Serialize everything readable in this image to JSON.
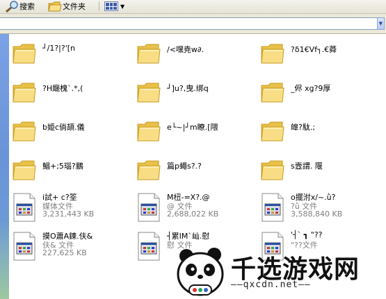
{
  "toolbar": {
    "search_label": "搜索",
    "folders_label": "文件夹",
    "search_icon": "magnifier-icon",
    "folders_icon": "folder-icon",
    "views_icon": "views-grid-icon"
  },
  "address": {
    "value": ""
  },
  "folders": [
    {
      "name": "┘/1?|?'[n"
    },
    {
      "name": "/<嘿尭w∂."
    },
    {
      "name": "?δ1€Vf┐.€蕣"
    },
    {
      "name": "?H廰槐`.*,("
    },
    {
      "name": "┘]u?,曳.绑q"
    },
    {
      "name": "_侭  xg?9厚"
    },
    {
      "name": "b姫c倘頡.儀"
    },
    {
      "name": "e└~|┘m瞭.[隈"
    },
    {
      "name": "皥?駄.;"
    },
    {
      "name": "鯧+;5瑙?鵬"
    },
    {
      "name": "篇p蠅s?.?"
    },
    {
      "name": "s壼謂. 隁"
    }
  ],
  "files": [
    {
      "name": "i試+   c?筌",
      "type": "媒体文件",
      "size": "3,231,443 KB"
    },
    {
      "name": "M杻-=X?.@",
      "type": "@   文件",
      "size": "2,688,022 KB"
    },
    {
      "name": "o擺泭x/~.ǜ?",
      "type": "?ǜ 文件",
      "size": "3,588,840 KB"
    },
    {
      "name": "摸O蕭A鍊.伕&",
      "type": "伕& 文件",
      "size": "227,625 KB"
    },
    {
      "name": "┤累IM`屾.慰",
      "type": "慰 文件",
      "size": ""
    },
    {
      "name": "'┤`  ┓  \"??",
      "type": "\"??文件",
      "size": ""
    }
  ],
  "watermark": {
    "text": "千选游戏网",
    "url": "——qxcdn.net——"
  },
  "colors": {
    "folder_yellow": "#f5d35f",
    "left_panel_blue": "#6a93d8"
  }
}
